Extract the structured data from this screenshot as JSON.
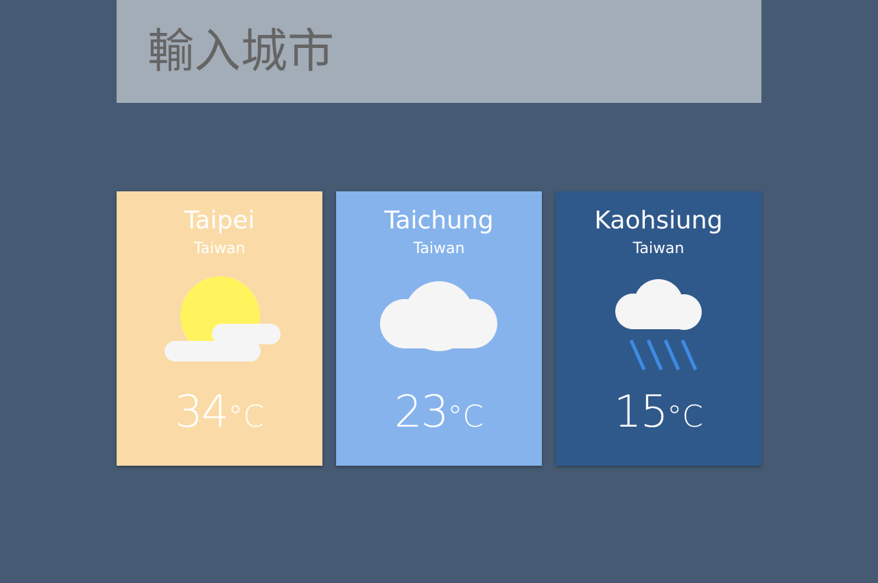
{
  "search": {
    "placeholder": "輸入城市"
  },
  "cards": [
    {
      "city": "Taipei",
      "country": "Taiwan",
      "temperature": "34",
      "unit": "°C",
      "condition_icon": "sun-behind-cloud-icon",
      "background": "#FADBA7"
    },
    {
      "city": "Taichung",
      "country": "Taiwan",
      "temperature": "23",
      "unit": "°C",
      "condition_icon": "cloud-icon",
      "background": "#86B3EC"
    },
    {
      "city": "Kaohsiung",
      "country": "Taiwan",
      "temperature": "15",
      "unit": "°C",
      "condition_icon": "rain-cloud-icon",
      "background": "#30598B"
    }
  ],
  "colors": {
    "page_background": "#465B73",
    "search_background": "#A3ADB8",
    "search_text": "#656565",
    "sun": "#FFF45E",
    "cloud": "#F5F5F5",
    "rain": "#3D8BE5"
  }
}
